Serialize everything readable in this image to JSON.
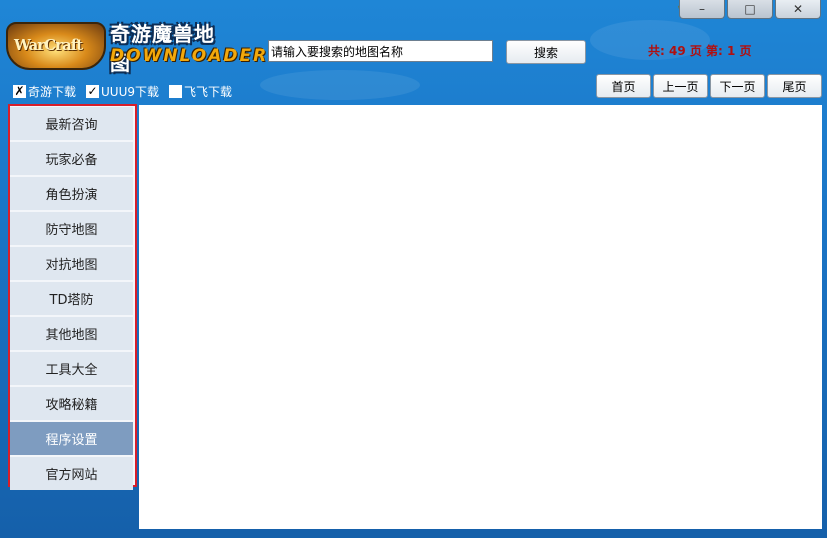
{
  "app": {
    "title_cn": "奇游魔兽地图",
    "title_en": "DOWNLOADER",
    "logo_text": "WarCraft"
  },
  "window_controls": {
    "minimize": "–",
    "maximize": "□",
    "close": "✕",
    "skin_icon": "crown-icon"
  },
  "search": {
    "value": "请输入要搜索的地图名称",
    "button": "搜索"
  },
  "pagination": {
    "total_label": "共: 49 页 第: 1 页",
    "first": "首页",
    "prev": "上一页",
    "next": "下一页",
    "last": "尾页"
  },
  "sources": [
    {
      "label": "奇游下载",
      "mark": "✗",
      "checked": true
    },
    {
      "label": "UUU9下载",
      "mark": "✓",
      "checked": true
    },
    {
      "label": "飞飞下载",
      "mark": "",
      "checked": false
    }
  ],
  "sidebar": {
    "items": [
      {
        "label": "最新咨询"
      },
      {
        "label": "玩家必备"
      },
      {
        "label": "角色扮演"
      },
      {
        "label": "防守地图"
      },
      {
        "label": "对抗地图"
      },
      {
        "label": "TD塔防"
      },
      {
        "label": "其他地图"
      },
      {
        "label": "工具大全"
      },
      {
        "label": "攻略秘籍"
      },
      {
        "label": "程序设置",
        "active": true
      },
      {
        "label": "官方网站"
      }
    ]
  },
  "colors": {
    "highlight_border": "#d81e2a",
    "page_info": "#b01010",
    "background": "#1a73c4",
    "active_item": "#7e9cc0"
  }
}
